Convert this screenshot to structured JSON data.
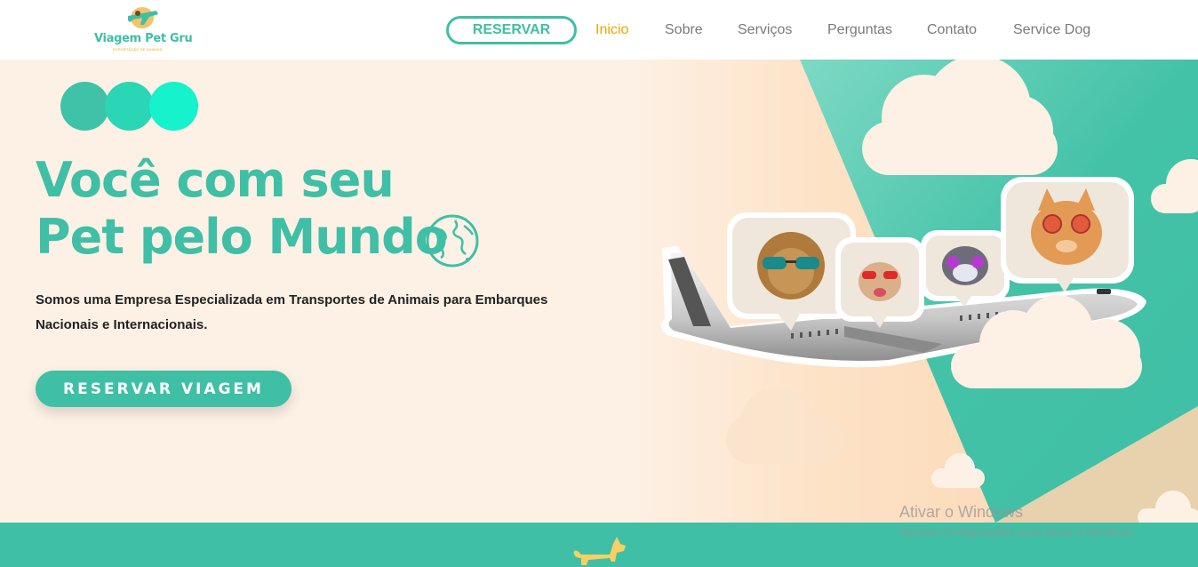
{
  "header": {
    "logo_name": "Viagem Pet Gru",
    "logo_subtitle": "EXPORTAÇÃO DE ANIMAIS",
    "reserve_button": "RESERVAR",
    "nav": [
      {
        "label": "Inicio",
        "active": true
      },
      {
        "label": "Sobre",
        "active": false
      },
      {
        "label": "Serviços",
        "active": false
      },
      {
        "label": "Perguntas",
        "active": false
      },
      {
        "label": "Contato",
        "active": false
      },
      {
        "label": "Service Dog",
        "active": false
      }
    ]
  },
  "hero": {
    "title_line1": "Você com seu",
    "title_line2": "Pet pelo Mundo",
    "description": "Somos uma Empresa Especializada em Transportes de Animais para Embarques Nacionais e Internacionais.",
    "cta": "RESERVAR VIAGEM",
    "dots_colors": [
      "#40c2a9",
      "#2ad6b6",
      "#16f2cb"
    ],
    "illustration": "airplane-with-pets-icon"
  },
  "watermark": {
    "title": "Ativar o Windows",
    "subtitle": "Acesse Configurações para ativar o Windows."
  },
  "colors": {
    "accent": "#3fbfa5",
    "active_nav": "#f0a500",
    "hero_bg": "#fdf1e6",
    "peach": "#fbd9b8"
  }
}
